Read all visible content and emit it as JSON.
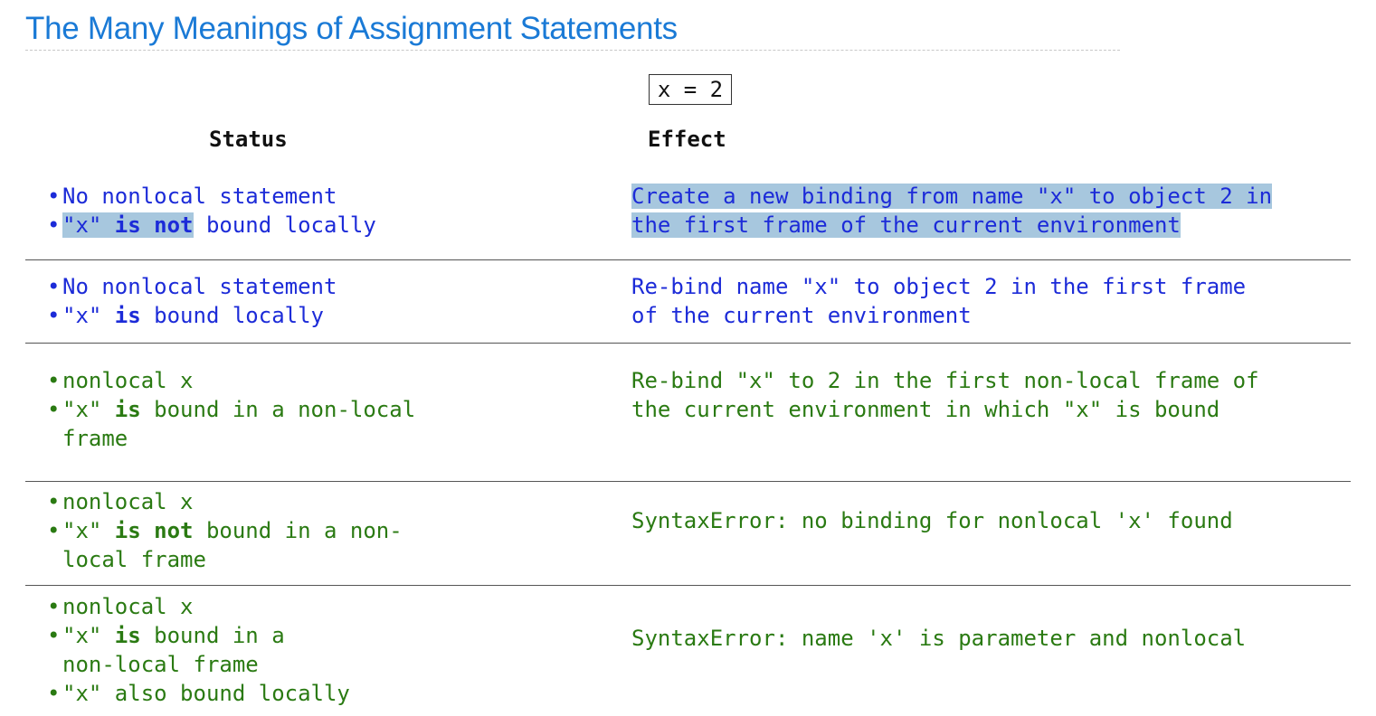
{
  "title": "The Many Meanings of Assignment Statements",
  "code": "x = 2",
  "headers": {
    "status": "Status",
    "effect": "Effect"
  },
  "rows": [
    {
      "status": [
        {
          "pre": "No nonlocal statement"
        },
        {
          "pre": "\"x\" ",
          "bold": "is not",
          "post": " bound locally"
        }
      ],
      "effect": [
        "Create a new binding from name \"x\" to object 2 in",
        "the first frame of the current environment"
      ]
    },
    {
      "status": [
        {
          "pre": "No nonlocal statement"
        },
        {
          "pre": "\"x\" ",
          "bold": "is",
          "post": " bound locally"
        }
      ],
      "effect": [
        "Re-bind name \"x\" to object 2 in the first frame",
        "of the current environment"
      ]
    },
    {
      "status": [
        {
          "pre": "nonlocal x"
        },
        {
          "pre": "\"x\" ",
          "bold": "is",
          "post": " bound in a non-local"
        },
        {
          "pre": "frame"
        }
      ],
      "effect": [
        "Re-bind \"x\" to 2 in the first non-local frame of",
        "the current environment in which \"x\" is bound"
      ]
    },
    {
      "status": [
        {
          "pre": "nonlocal x"
        },
        {
          "pre": "\"x\" ",
          "bold": "is not",
          "post": " bound in a non-"
        },
        {
          "pre": "local frame"
        }
      ],
      "effect": [
        "SyntaxError: no binding for nonlocal 'x' found"
      ]
    },
    {
      "status": [
        {
          "pre": "nonlocal x"
        },
        {
          "pre": "\"x\" ",
          "bold": "is",
          "post": " bound in a"
        },
        {
          "pre": "non-local frame"
        },
        {
          "pre": "\"x\" also bound locally"
        }
      ],
      "effect": [
        "SyntaxError: name 'x' is parameter and nonlocal"
      ]
    }
  ],
  "colors": {
    "title": "#1a7ad6",
    "blue_text": "#1c2bd8",
    "green_text": "#2a7a12",
    "highlight": "#a7c7de"
  }
}
